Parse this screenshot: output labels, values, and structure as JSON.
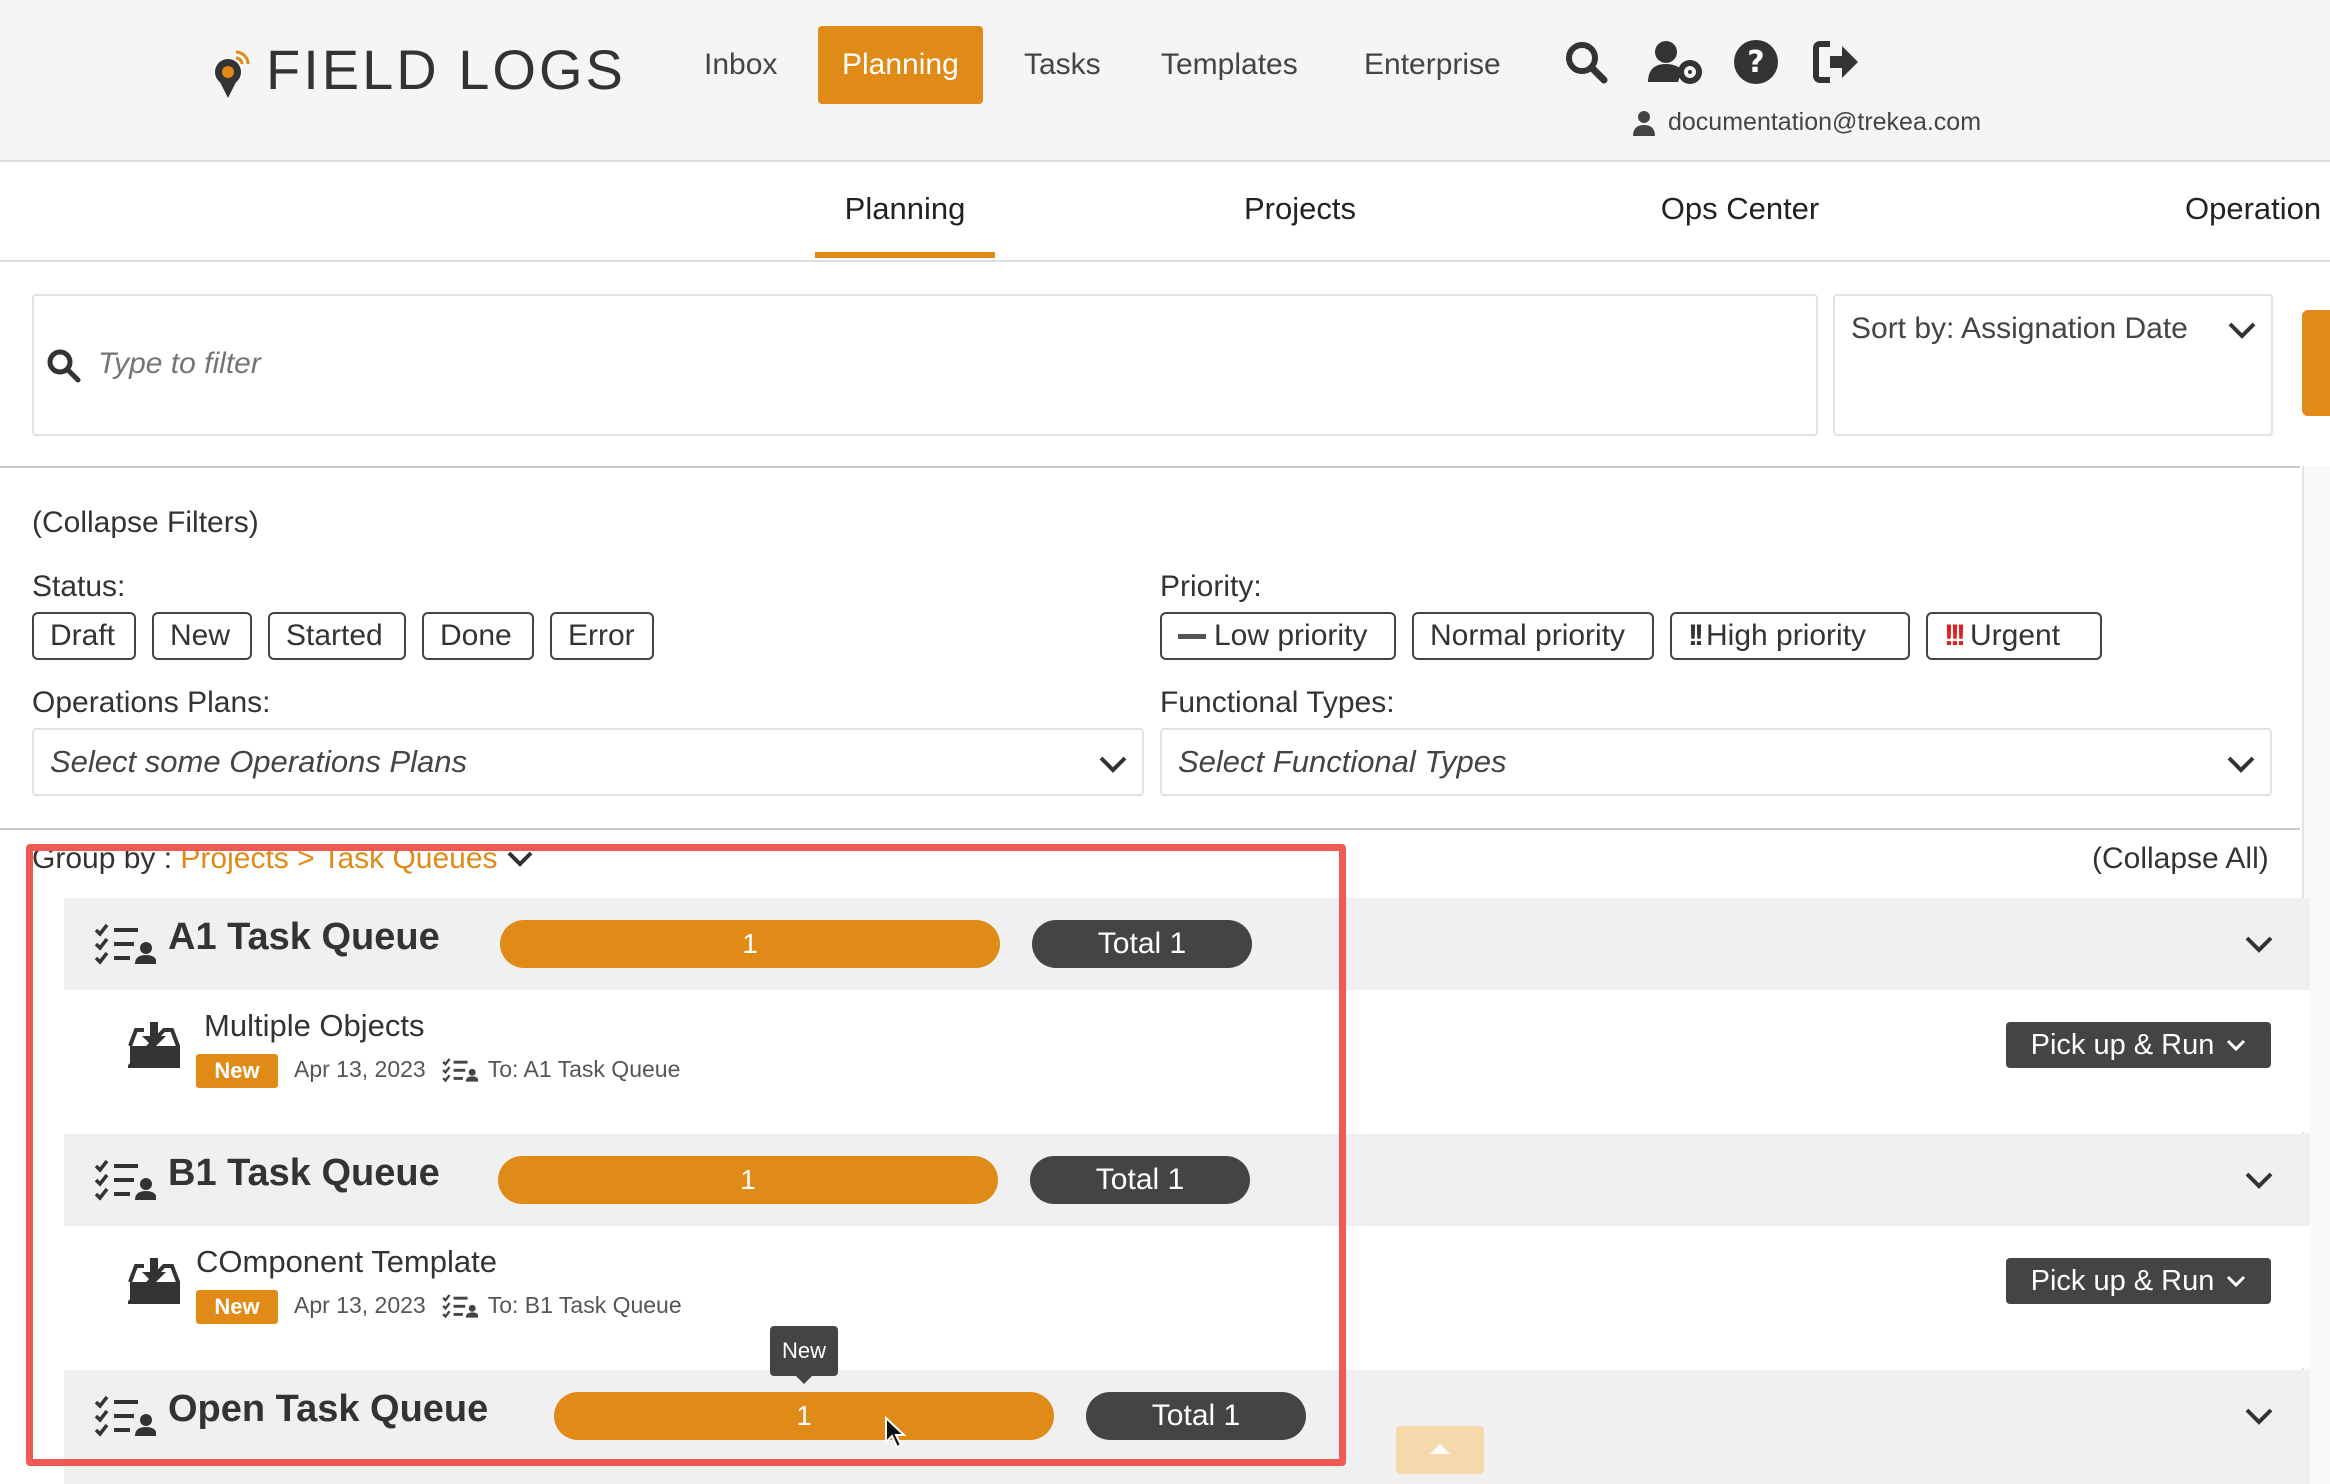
{
  "app": {
    "brand": "FIELD LOGS"
  },
  "topnav": {
    "items": [
      {
        "label": "Inbox"
      },
      {
        "label": "Planning"
      },
      {
        "label": "Tasks"
      },
      {
        "label": "Templates"
      },
      {
        "label": "Enterprise"
      }
    ],
    "active": "Planning",
    "icons": [
      "search-icon",
      "user-settings-icon",
      "help-icon",
      "logout-icon"
    ],
    "user_email": "documentation@trekea.com"
  },
  "subnav": {
    "tabs": [
      {
        "label": "Planning"
      },
      {
        "label": "Projects"
      },
      {
        "label": "Ops Center"
      },
      {
        "label": "Operation"
      }
    ]
  },
  "search": {
    "placeholder": "Type to filter",
    "value": ""
  },
  "sort": {
    "label": "Sort by: Assignation Date"
  },
  "filters": {
    "collapse_label": "(Collapse Filters)",
    "status_label": "Status:",
    "status_chips": [
      {
        "label": "Draft"
      },
      {
        "label": "New"
      },
      {
        "label": "Started"
      },
      {
        "label": "Done"
      },
      {
        "label": "Error"
      }
    ],
    "priority_label": "Priority:",
    "priority_chips": [
      {
        "label": "Low priority"
      },
      {
        "label": "Normal priority"
      },
      {
        "label": "High priority"
      },
      {
        "label": "Urgent"
      }
    ],
    "operations_plans_label": "Operations Plans:",
    "operations_plans_placeholder": "Select some Operations Plans",
    "functional_types_label": "Functional Types:",
    "functional_types_placeholder": "Select Functional Types"
  },
  "grouping": {
    "prefix": "Group by :",
    "value": "Projects > Task Queues",
    "collapse_all": "(Collapse All)"
  },
  "queues": [
    {
      "title": "A1 Task Queue",
      "count": "1",
      "total": "Total 1",
      "task": {
        "title": "Multiple Objects",
        "status": "New",
        "date": "Apr 13, 2023",
        "to": "To: A1 Task Queue",
        "action": "Pick up & Run"
      }
    },
    {
      "title": "B1 Task Queue",
      "count": "1",
      "total": "Total 1",
      "task": {
        "title": "COmponent Template",
        "status": "New",
        "date": "Apr 13, 2023",
        "to": "To: B1 Task Queue",
        "action": "Pick up & Run"
      }
    },
    {
      "title": "Open Task Queue",
      "count": "1",
      "total": "Total 1"
    }
  ],
  "tooltip": {
    "text": "New"
  },
  "colors": {
    "accent": "#e08a17",
    "dark": "#444444",
    "highlight": "#ef5a55",
    "urgent": "#e02020"
  }
}
